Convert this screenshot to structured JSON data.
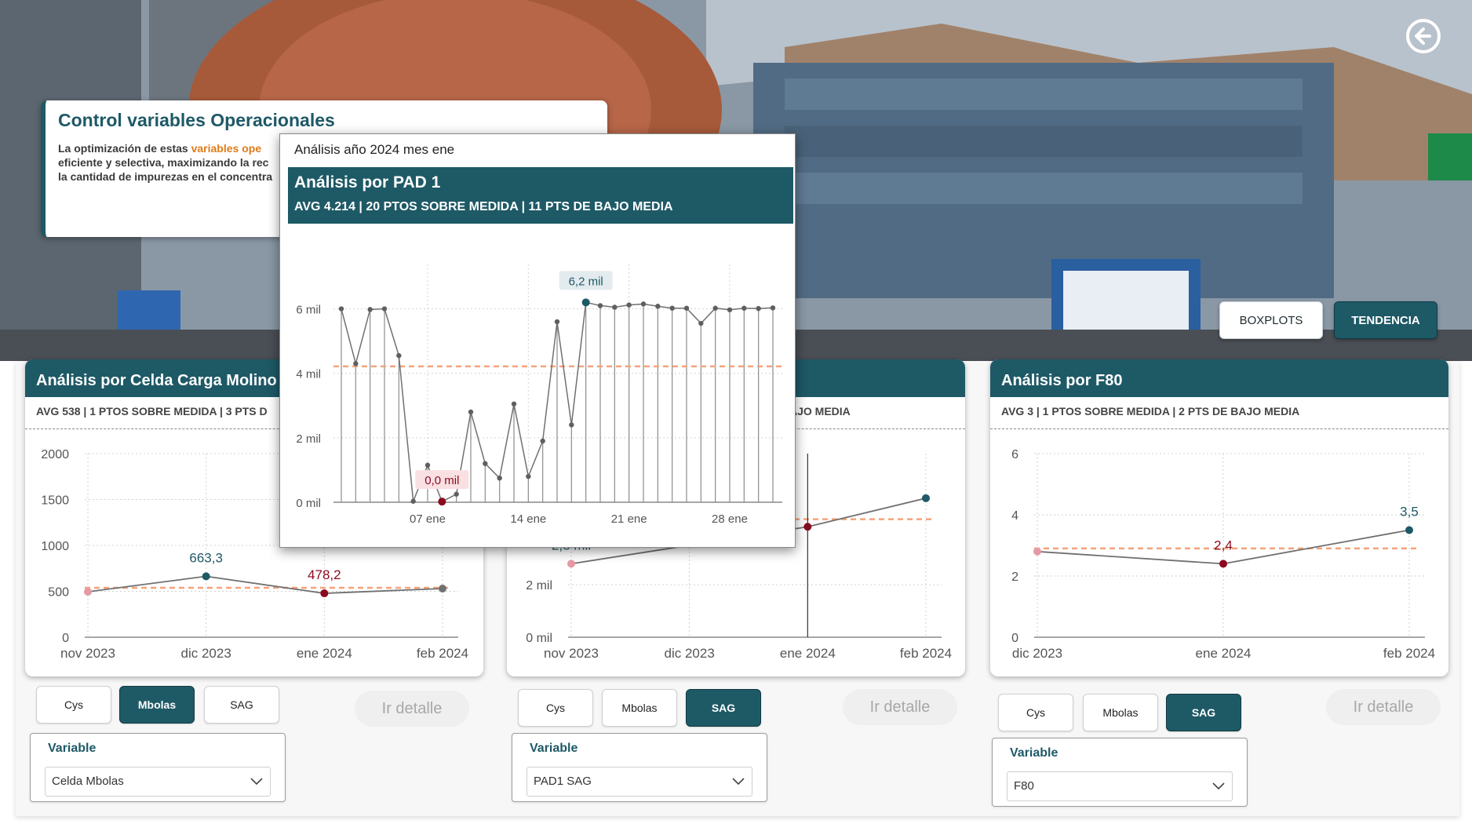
{
  "back_button": {
    "icon": "back-arrow-icon"
  },
  "view_toggle": {
    "boxplots_label": "BOXPLOTS",
    "tendencia_label": "TENDENCIA",
    "active": "TENDENCIA"
  },
  "header": {
    "title": "Control variables Operacionales",
    "desc_part1": "La optimización de estas ",
    "desc_highlight": "variables ope",
    "desc_line2": "eficiente y selectiva, maximizando la rec",
    "desc_line3": "la cantidad de impurezas en el concentra"
  },
  "colors": {
    "primary": "#1e5966",
    "avg_line": "#f4a37a",
    "highlight_orange": "#e07b1a",
    "low_point": "#8b0a1e",
    "high_point": "#1e5966",
    "first_point": "#e59aa6",
    "line_gray": "#707070"
  },
  "panels": [
    {
      "title": "Análisis por Celda Carga Molino de",
      "subtitle": "AVG 538 |  1 PTOS SOBRE MEDIDA | 3 PTS D",
      "buttons": [
        "Cys",
        "Mbolas",
        "SAG"
      ],
      "active_button": "Mbolas",
      "detail_label": "Ir detalle",
      "variable_label": "Variable",
      "variable_value": "Celda Mbolas",
      "variable_icon": "chevron-down-icon"
    },
    {
      "title": "",
      "subtitle": "AJO MEDIA",
      "buttons": [
        "Cys",
        "Mbolas",
        "SAG"
      ],
      "active_button": "SAG",
      "detail_label": "Ir detalle",
      "variable_label": "Variable",
      "variable_value": "PAD1 SAG",
      "variable_icon": "chevron-down-icon"
    },
    {
      "title": "Análisis por F80",
      "subtitle": "AVG 3 |  1 PTOS SOBRE MEDIDA | 2 PTS DE BAJO MEDIA",
      "buttons": [
        "Cys",
        "Mbolas",
        "SAG"
      ],
      "active_button": "SAG",
      "detail_label": "Ir detalle",
      "variable_label": "Variable",
      "variable_value": "F80",
      "variable_icon": "chevron-down-icon"
    }
  ],
  "popup": {
    "caption": "Análisis año 2024 mes ene",
    "title": "Análisis por PAD 1",
    "stats": "AVG 4.214 |  20 PTOS SOBRE MEDIDA | 11 PTS DE BAJO MEDIA"
  },
  "chart_data": [
    {
      "id": "panel1",
      "type": "line",
      "categories": [
        "nov 2023",
        "dic 2023",
        "ene 2024",
        "feb 2024"
      ],
      "values": [
        495,
        663.3,
        478.2,
        530
      ],
      "labels": [
        "",
        "663,3",
        "478,2",
        ""
      ],
      "avg": 538,
      "ylim": [
        0,
        2000
      ],
      "yticks": [
        0,
        500,
        1000,
        1500,
        2000
      ],
      "ytick_labels": [
        "0",
        "500",
        "1000",
        "1500",
        "2000"
      ]
    },
    {
      "id": "panel2",
      "type": "line",
      "categories": [
        "nov 2023",
        "dic 2023",
        "ene 2024",
        "feb 2024"
      ],
      "values": [
        2.8,
        null,
        4.21,
        5.3
      ],
      "labels": [
        "2,8 mil",
        "",
        "",
        ""
      ],
      "avg": 4.5,
      "ylim": [
        0,
        7
      ],
      "yticks": [
        0,
        2
      ],
      "ytick_labels": [
        "0 mil",
        "2 mil"
      ]
    },
    {
      "id": "panel3",
      "type": "line",
      "categories": [
        "dic 2023",
        "ene 2024",
        "feb 2024"
      ],
      "values": [
        2.8,
        2.4,
        3.5
      ],
      "labels": [
        "",
        "2,4",
        "3,5"
      ],
      "avg": 2.9,
      "ylim": [
        0,
        6
      ],
      "yticks": [
        0,
        2,
        4,
        6
      ],
      "ytick_labels": [
        "0",
        "2",
        "4",
        "6"
      ]
    },
    {
      "id": "popup",
      "type": "line",
      "x": [
        1,
        2,
        3,
        4,
        5,
        6,
        7,
        8,
        9,
        10,
        11,
        12,
        13,
        14,
        15,
        16,
        17,
        18,
        19,
        20,
        21,
        22,
        23,
        24,
        25,
        26,
        27,
        28,
        29,
        30,
        31
      ],
      "values": [
        6.0,
        4.3,
        5.98,
        6.0,
        4.55,
        0.03,
        1.15,
        0.02,
        0.25,
        2.8,
        1.2,
        0.75,
        3.05,
        0.8,
        1.9,
        5.6,
        2.4,
        6.2,
        6.1,
        6.05,
        6.12,
        6.15,
        6.08,
        6.02,
        6.02,
        5.55,
        6.02,
        5.97,
        6.02,
        6.01,
        6.03
      ],
      "avg": 4.214,
      "ylim": [
        0,
        6.5
      ],
      "yticks": [
        0,
        2,
        4,
        6
      ],
      "ytick_labels": [
        "0 mil",
        "2 mil",
        "4 mil",
        "6 mil"
      ],
      "xticks": [
        7,
        14,
        21,
        28
      ],
      "xtick_labels": [
        "07 ene",
        "14 ene",
        "21 ene",
        "28 ene"
      ],
      "max_label": "6,2 mil",
      "min_label": "0,0 mil"
    }
  ]
}
